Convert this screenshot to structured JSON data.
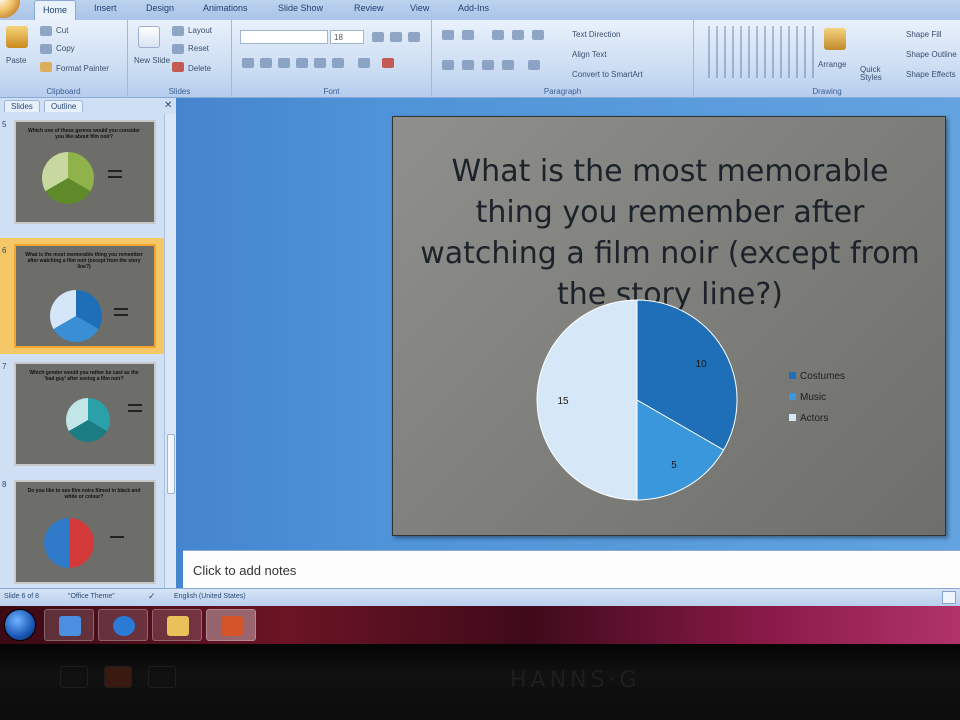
{
  "ribbon": {
    "tabs": [
      "Home",
      "Insert",
      "Design",
      "Animations",
      "Slide Show",
      "Review",
      "View",
      "Add-Ins"
    ],
    "active_tab": "Home",
    "clipboard": {
      "paste": "Paste",
      "cut": "Cut",
      "copy": "Copy",
      "format_painter": "Format Painter",
      "label": "Clipboard"
    },
    "slides": {
      "new_slide": "New Slide",
      "layout": "Layout",
      "reset": "Reset",
      "delete": "Delete",
      "label": "Slides"
    },
    "font": {
      "size": "18",
      "label": "Font"
    },
    "paragraph": {
      "text_direction": "Text Direction",
      "align_text": "Align Text",
      "convert_smartart": "Convert to SmartArt",
      "label": "Paragraph"
    },
    "drawing": {
      "arrange": "Arrange",
      "quick_styles": "Quick Styles",
      "shape_fill": "Shape Fill",
      "shape_outline": "Shape Outline",
      "shape_effects": "Shape Effects",
      "label": "Drawing"
    }
  },
  "pane": {
    "tabs": [
      "Slides",
      "Outline"
    ],
    "thumbnails": [
      {
        "number": "5",
        "title": "Which one of these genres would you consider you like about film noir?",
        "pie_colors": [
          "#8fb34a",
          "#5f8a2a",
          "#c8d9a0"
        ]
      },
      {
        "number": "6",
        "title": "What is the most memorable thing you remember after watching a film noir (except from the story line?)",
        "pie_colors": [
          "#1f6fb8",
          "#3a8fd4",
          "#d4e6f7"
        ]
      },
      {
        "number": "7",
        "title": "Which gender would you rather be cast as the 'bad guy' after seeing a film noir?",
        "pie_colors": [
          "#2aa0a8",
          "#1c7c84",
          "#c2e6e8"
        ]
      },
      {
        "number": "8",
        "title": "Do you like to see film noirs filmed in black and white or colour?",
        "pie_colors": [
          "#d43a3a",
          "#2f7ac8"
        ]
      }
    ]
  },
  "slide": {
    "title": "What is the most memorable thing you remember after watching a film noir (except from the story line?)"
  },
  "chart_data": {
    "type": "pie",
    "title": "",
    "series": [
      {
        "name": "Costumes",
        "value": 10,
        "color": "#1f6fb8"
      },
      {
        "name": "Music",
        "value": 5,
        "color": "#3a97db"
      },
      {
        "name": "Actors",
        "value": 15,
        "color": "#d6e8f8"
      }
    ],
    "legend": "right",
    "data_labels": true
  },
  "notes": {
    "placeholder": "Click to add notes"
  },
  "status": {
    "slide_info": "Slide 6 of 8",
    "theme": "\"Office Theme\"",
    "language": "English (United States)"
  },
  "taskbar": {
    "items": [
      {
        "name": "explorer-icon",
        "color": "#4b8fe0"
      },
      {
        "name": "ie-icon",
        "color": "#2b7ad6"
      },
      {
        "name": "folder-icon",
        "color": "#e8c15a"
      },
      {
        "name": "powerpoint-icon",
        "color": "#d4552a"
      }
    ]
  },
  "bezel": {
    "brand": "HANNS·G"
  }
}
